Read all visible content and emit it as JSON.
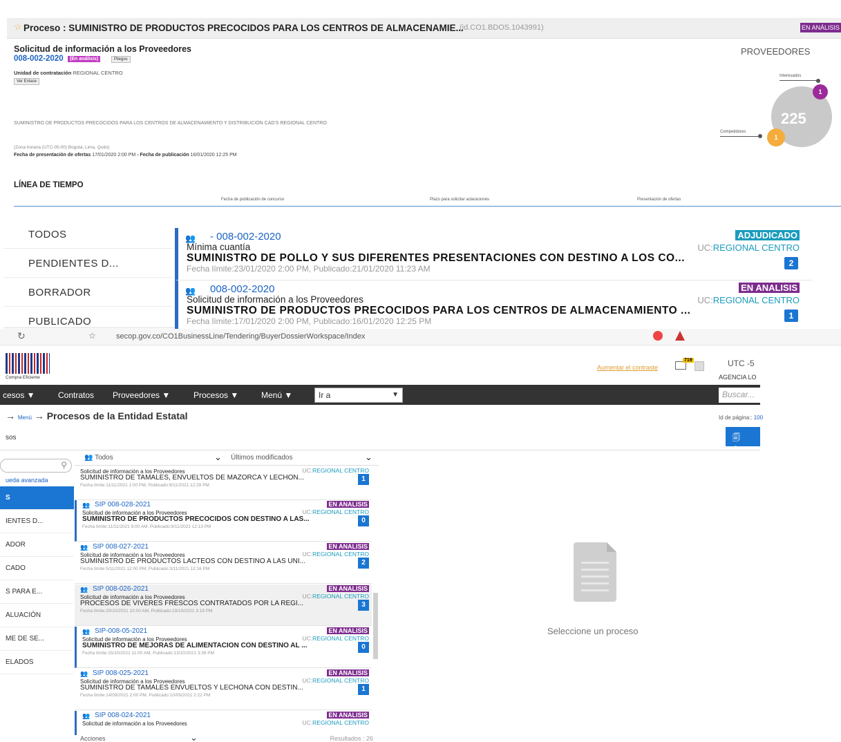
{
  "colors": {
    "link": "#1a63c4",
    "analysis_purple": "#7d2c8e",
    "adjudicado_teal": "#1a9bbd",
    "primary_blue": "#1a76d2",
    "navbar_dark": "#333333",
    "bubble_purple": "#9c2a9c",
    "bubble_orange": "#f4ac3d"
  },
  "detail": {
    "star_icon": "star-icon",
    "title": "Proceso : SUMINISTRO DE PRODUCTOS PRECOCIDOS PARA LOS CENTROS DE ALMACENAMIE...",
    "process_id": "(id.CO1.BDOS.1043991)",
    "status": "EN ANÁLISIS",
    "request_title": "Solicitud de información a los Proveedores",
    "request_number": "008-002-2020",
    "analysis_tag": "(En análisis)",
    "pliegos_label": "Pliegos",
    "unidad_label": "Unidad de contratación",
    "unidad_value": "REGIONAL CENTRO",
    "ver_enlace": "Ver Enlace",
    "description": "SUMINISTRO DE PRODUCTOS PRECOCIDOS PARA LOS CENTROS DE ALMACENAMIENTO Y DISTRIBUCIÓN CAD'S REGIONAL CENTRO",
    "timezone": "(Zona horaria (UTC-05:00) Bogotá, Lima, Quito)",
    "fecha_presentacion_label": "Fecha de presentación de ofertas",
    "fecha_presentacion": "17/01/2020 2:00 PM",
    "fecha_publicacion_label": "- Fecha de publicación",
    "fecha_publicacion": "16/01/2020 12:25 PM",
    "proveedores_heading": "PROVEEDORES",
    "interesados_label": "Interesados",
    "interesados_count": "1",
    "competidores_label": "Competidores",
    "competidores_count": "1",
    "total_count": "225",
    "timeline_heading": "LÍNEA DE TIEMPO",
    "timeline_labels": [
      "Fecha de publicación de concurso",
      "Plazo para solicitar aclaraciones",
      "Presentación de ofertas"
    ]
  },
  "zoom_list": {
    "nav": [
      "TODOS",
      "PENDIENTES D...",
      "BORRADOR",
      "PUBLICADO"
    ],
    "rows": [
      {
        "number": "- 008-002-2020",
        "modality": "Mínima cuantía",
        "name": "SUMINISTRO DE POLLO Y SUS DIFERENTES PRESENTACIONES CON DESTINO A LOS CO...",
        "dates": "Fecha límite:23/01/2020 2:00 PM, Publicado:21/01/2020 11:23 AM",
        "status": "ADJUDICADO",
        "status_color": "#1a9bbd",
        "uc_prefix": "UC:",
        "uc": "REGIONAL CENTRO",
        "count": "2"
      },
      {
        "number": "008-002-2020",
        "modality": "Solicitud de información a los Proveedores",
        "name": "SUMINISTRO DE PRODUCTOS PRECOCIDOS PARA LOS CENTROS DE ALMACENAMIENTO ...",
        "dates": "Fecha límite:17/01/2020 2:00 PM, Publicado:16/01/2020 12:25 PM",
        "status": "EN ANALISIS",
        "status_color": "#7d2c8e",
        "uc_prefix": "UC:",
        "uc": "REGIONAL CENTRO",
        "count": "1"
      }
    ]
  },
  "browser": {
    "url": "secop.gov.co/CO1BusinessLine/Tendering/BuyerDossierWorkspace/Index",
    "logo_caption": "Compra Eficiente",
    "contrast_link": "Aumentar el contraste",
    "mail_badge": "719",
    "utc": "UTC -5",
    "agency": "AGENCIA LO",
    "menu": [
      "cesos ▼",
      "Contratos",
      "Proveedores ▼",
      "Procesos ▼",
      "Menú ▼"
    ],
    "goto_value": "Ir a",
    "search_placeholder": "Buscar...",
    "breadcrumb_arrow1": "→",
    "breadcrumb_menu": "Menú",
    "breadcrumb_arrow2": "→",
    "breadcrumb_title": "Procesos de la Entidad Estatal",
    "page_id_label": "Id de página::",
    "page_id": "100",
    "section": "sos",
    "create_label": "Crea",
    "advanced_search": "ueda avanzada",
    "left_nav": [
      "S",
      "IENTES D...",
      "ADOR",
      "CADO",
      "S PARA E...",
      "ALUACIÓN",
      "ME DE SE...",
      "ELADOS"
    ],
    "filter_all": "Todos",
    "filter_sort": "Últimos modificados",
    "list": [
      {
        "number": "SIP 008-029-2021",
        "modality": "Solicitud de información a los Proveedores",
        "name": "SUMINISTRO DE TAMALES, ENVUELTOS DE MAZORCA Y LECHON...",
        "bold": false,
        "dates": "Fecha límite:11/11/2021 1:00 PM, Publicado:9/11/2021 12:29 PM",
        "status": "EN ANALISIS",
        "uc_prefix": "UC:",
        "uc": "REGIONAL CENTRO",
        "count": "1",
        "hl": false,
        "grey": false
      },
      {
        "number": "SIP 008-028-2021",
        "modality": "Solicitud de información a los Proveedores",
        "name": "SUMINISTRO DE PRODUCTOS PRECOCIDOS CON DESTINO A LAS...",
        "bold": true,
        "dates": "Fecha límite:11/11/2021 9:00 AM, Publicado:9/11/2021 12:13 PM",
        "status": "EN ANALISIS",
        "uc_prefix": "UC:",
        "uc": "REGIONAL CENTRO",
        "count": "0",
        "hl": true,
        "grey": false
      },
      {
        "number": "SIP 008-027-2021",
        "modality": "Solicitud de información a los Proveedores",
        "name": "SUMINISTRO DE PRODUCTOS LACTEOS CON DESTINO A LAS UNI...",
        "bold": false,
        "dates": "Fecha límite:5/11/2021 12:00 PM, Publicado:3/11/2021 12:16 PM",
        "status": "EN ANALISIS",
        "uc_prefix": "UC:",
        "uc": "REGIONAL CENTRO",
        "count": "2",
        "hl": false,
        "grey": false
      },
      {
        "number": "SIP 008-026-2021",
        "modality": "Solicitud de información a los Proveedores",
        "name": "PROCESOS DE VIVERES FRESCOS CONTRATADOS POR LA REGI...",
        "bold": false,
        "dates": "Fecha límite:20/10/2021 10:00 AM, Publicado:19/10/2021 3:19 PM",
        "status": "EN ANALISIS",
        "uc_prefix": "UC:",
        "uc": "REGIONAL CENTRO",
        "count": "3",
        "hl": false,
        "grey": true
      },
      {
        "number": "SIP-008-05-2021",
        "modality": "Solicitud de información a los Proveedores",
        "name": "SUMINISTRO DE MEJORAS DE ALIMENTACION CON DESTINO AL ...",
        "bold": true,
        "dates": "Fecha límite:15/10/2021 11:00 AM, Publicado:13/10/2021 3:36 PM",
        "status": "EN ANALISIS",
        "uc_prefix": "UC:",
        "uc": "REGIONAL CENTRO",
        "count": "0",
        "hl": true,
        "grey": false
      },
      {
        "number": "SIP 008-025-2021",
        "modality": "Solicitud de información a los Proveedores",
        "name": "SUMINISTRO DE TAMALES ENVUELTOS Y LECHONA CON DESTIN...",
        "bold": false,
        "dates": "Fecha límite:14/09/2021 2:00 PM, Publicado:10/09/2021 2:22 PM",
        "status": "EN ANALISIS",
        "uc_prefix": "UC:",
        "uc": "REGIONAL CENTRO",
        "count": "1",
        "hl": false,
        "grey": false
      },
      {
        "number": "SIP 008-024-2021",
        "modality": "Solicitud de información a los Proveedores",
        "name": "",
        "bold": false,
        "dates": "",
        "status": "EN ANALISIS",
        "uc_prefix": "UC:",
        "uc": "REGIONAL CENTRO",
        "count": "",
        "hl": true,
        "grey": false
      }
    ],
    "footer_actions": "Acciones",
    "footer_results": "Resultados : 26",
    "empty_label": "Seleccione un proceso"
  }
}
